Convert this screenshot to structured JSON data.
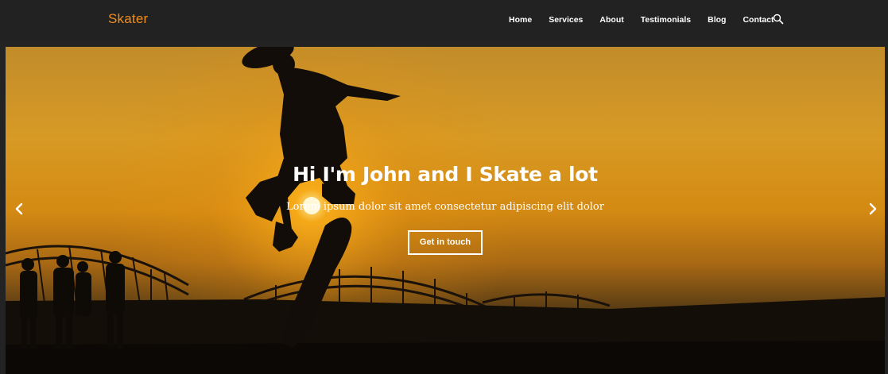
{
  "brand": {
    "name": "Skater"
  },
  "nav": {
    "items": [
      {
        "label": "Home"
      },
      {
        "label": "Services"
      },
      {
        "label": "About"
      },
      {
        "label": "Testimonials"
      },
      {
        "label": "Blog"
      },
      {
        "label": "Contact"
      }
    ],
    "search_icon": "search-icon"
  },
  "hero": {
    "title": "Hi I'm John and I Skate a lot",
    "subtitle": "Lorem ipsum dolor sit amet consectetur adipiscing elit dolor",
    "cta_label": "Get in touch",
    "prev_icon": "chevron-left-icon",
    "next_icon": "chevron-right-icon"
  },
  "colors": {
    "navbar_bg": "#222222",
    "brand": "#ef8d1c",
    "nav_text": "#ffffff",
    "hero_sky": "#d79a24",
    "silhouette": "#120d08"
  }
}
